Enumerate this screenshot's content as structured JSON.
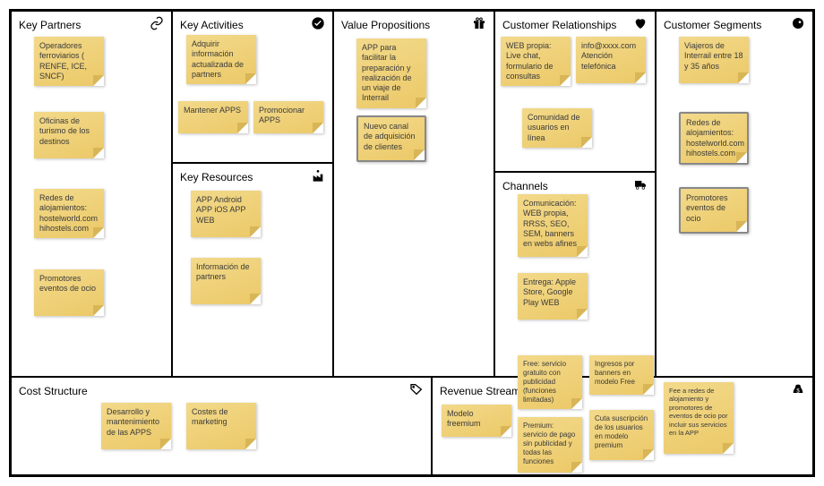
{
  "blocks": {
    "key_partners": {
      "title": "Key Partners",
      "icon": "link"
    },
    "key_activities": {
      "title": "Key Activities",
      "icon": "check"
    },
    "key_resources": {
      "title": "Key Resources",
      "icon": "factory"
    },
    "value_propositions": {
      "title": "Value Propositions",
      "icon": "gift"
    },
    "customer_relationships": {
      "title": "Customer Relationships",
      "icon": "heart"
    },
    "channels": {
      "title": "Channels",
      "icon": "truck"
    },
    "customer_segments": {
      "title": "Customer Segments",
      "icon": "user"
    },
    "cost_structure": {
      "title": "Cost Structure",
      "icon": "tag"
    },
    "revenue_streams": {
      "title": "Revenue Streams",
      "icon": "money"
    }
  },
  "notes": {
    "kp1": "Operadores ferroviarios ( RENFE, ICE, SNCF)",
    "kp2": "Oficinas de turismo de los destinos",
    "kp3": "Redes de alojamientos: hostelworld.com hihostels.com",
    "kp4": "Promotores eventos de ocio",
    "ka1": "Adquirir información actualizada de partners",
    "ka2": "Mantener APPS",
    "ka3": "Promocionar APPS",
    "kr1": "APP Android APP iOS APP WEB",
    "kr2": "Información de partners",
    "vp1": "APP para facilitar la preparación y realización de un viaje de Interrail",
    "vp2": "Nuevo canal de adquisición de clientes",
    "cr1": "WEB propia: Live chat, formulario de consultas",
    "cr2": "info@xxxx.com Atención telefónica",
    "cr3": "Comunidad de usuarios en línea",
    "ch1": "Comunicación: WEB propia, RRSS, SEO, SEM, banners en webs afines",
    "ch2": "Entrega: Apple Store, Google Play WEB",
    "cs1": "Viajeros de Interrail entre 18 y 35 años",
    "cs2": "Redes de alojamientos: hostelworld.com hihostels.com",
    "cs3": "Promotores eventos de ocio",
    "co1": "Desarrollo y mantenimiento de las APPS",
    "co2": "Costes de marketing",
    "rs1": "Modelo freemium",
    "rs2": "Free: servicio gratuito con publicidad (funciones limitadas)",
    "rs3": "Premium: servicio de pago sin publicidad y todas las funciones",
    "rs4": "Ingresos por banners en modelo Free",
    "rs5": "Cuta suscripción de los usuarios en modelo premium",
    "rs6": "Fee a redes de alojamiento y promotores de eventos de ocio por incluir sus servicios en la APP"
  }
}
